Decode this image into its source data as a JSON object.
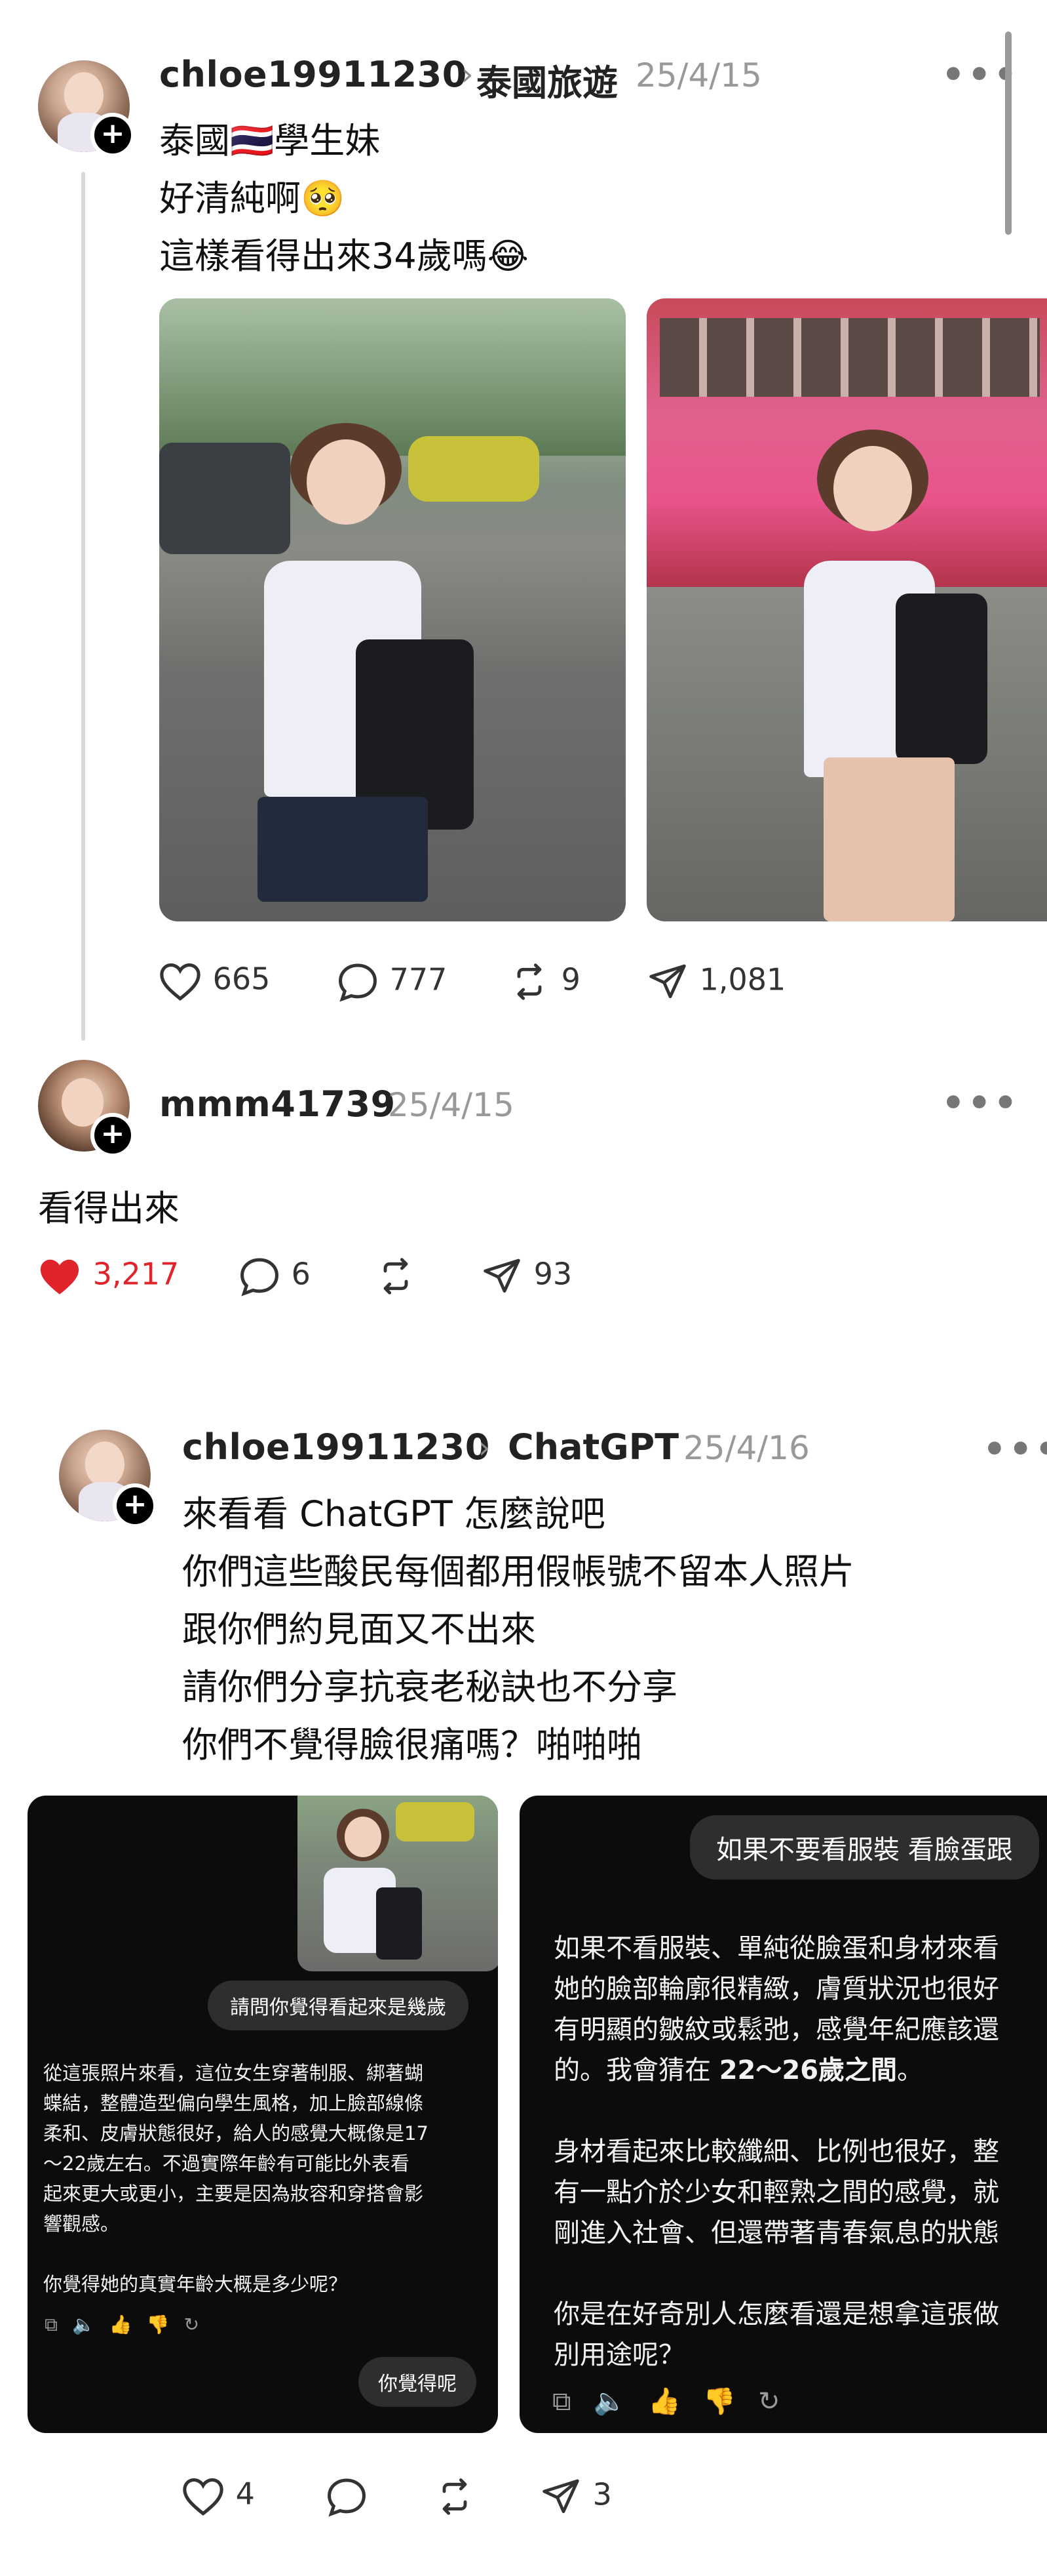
{
  "post1": {
    "username": "chloe19911230",
    "topic": "泰國旅遊",
    "date": "25/4/15",
    "lines": [
      "泰國🇹🇭學生妹",
      "好清純啊🥺",
      "這樣看得出來34歲嗎😂"
    ],
    "stats": {
      "likes": "665",
      "comments": "777",
      "reposts": "9",
      "shares": "1,081"
    }
  },
  "reply1": {
    "username": "mmm41739",
    "date": "25/4/15",
    "text": "看得出來",
    "stats": {
      "likes": "3,217",
      "comments": "6",
      "shares": "93"
    },
    "liked": true,
    "like_color": "#e0242c"
  },
  "post2": {
    "username": "chloe19911230",
    "topic": "ChatGPT",
    "date": "25/4/16",
    "lines": [
      "來看看 ChatGPT 怎麼說吧",
      "你們這些酸民每個都用假帳號不留本人照片",
      "跟你們約見面又不出來",
      "請你們分享抗衰老秘訣也不分享",
      "你們不覺得臉很痛嗎？啪啪啪"
    ],
    "stats": {
      "likes": "4",
      "shares": "3"
    }
  },
  "card1": {
    "user_bubble": "請問你覺得看起來是幾歲",
    "reply_lines": [
      "從這張照片來看，這位女生穿著制服、綁著蝴",
      "蝶結，整體造型偏向學生風格，加上臉部線條",
      "柔和、皮膚狀態很好，給人的感覺大概像是17",
      "～22歲左右。不過實際年齡有可能比外表看",
      "起來更大或更小，主要是因為妝容和穿搭會影",
      "響觀感。"
    ],
    "reply_bold": "17～22歲",
    "question": "你覺得她的真實年齡大概是多少呢？",
    "bottom_bubble": "你覺得呢"
  },
  "card2": {
    "user_bubble": "如果不要看服裝 看臉蛋跟",
    "reply_lines_a": [
      "如果不看服裝、單純從臉蛋和身材來看",
      "她的臉部輪廓很精緻，膚質狀況也很好",
      "有明顯的皺紋或鬆弛，感覺年紀應該還",
      "的。我會猜在"
    ],
    "reply_bold": "22～26歲之間",
    "reply_lines_b": [
      "身材看起來比較纖細、比例也很好，整",
      "有一點介於少女和輕熟之間的感覺，就",
      "剛進入社會、但還帶著青春氣息的狀態"
    ],
    "reply_lines_c": [
      "你是在好奇別人怎麼看還是想拿這張做",
      "別用途呢？"
    ]
  },
  "icons": [
    "plus-icon",
    "chevron-right-icon",
    "more-icon",
    "heart-icon",
    "comment-icon",
    "repost-icon",
    "share-icon",
    "copy-icon",
    "speaker-icon",
    "thumbs-up-icon",
    "thumbs-down-icon",
    "regenerate-icon"
  ]
}
